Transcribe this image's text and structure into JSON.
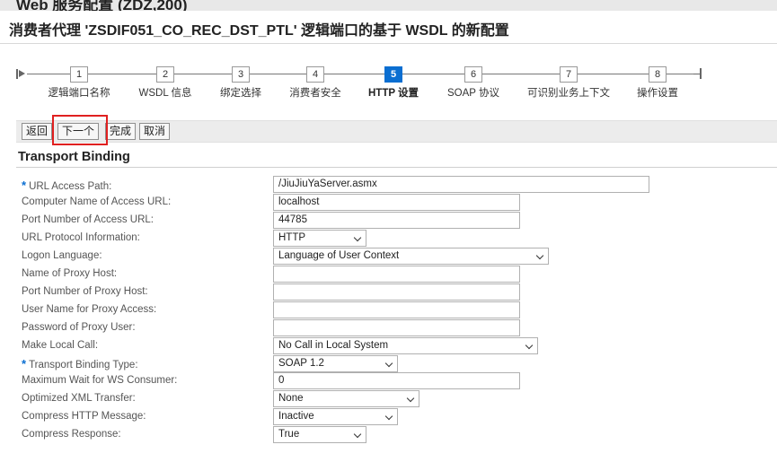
{
  "header": {
    "app_title": "Web 服务配置 (ZDZ,200)",
    "page_title": "消费者代理 'ZSDIF051_CO_REC_DST_PTL' 逻辑端口的基于 WSDL 的新配置"
  },
  "roadmap": {
    "steps": [
      {
        "num": "1",
        "label": "逻辑端口名称"
      },
      {
        "num": "2",
        "label": "WSDL 信息"
      },
      {
        "num": "3",
        "label": "绑定选择"
      },
      {
        "num": "4",
        "label": "消费者安全"
      },
      {
        "num": "5",
        "label": "HTTP 设置"
      },
      {
        "num": "6",
        "label": "SOAP 协议"
      },
      {
        "num": "7",
        "label": "可识别业务上下文"
      },
      {
        "num": "8",
        "label": "操作设置"
      }
    ],
    "active_step": "5"
  },
  "toolbar": {
    "back": "返回",
    "next": "下一个",
    "finish": "完成",
    "cancel": "取消"
  },
  "section": {
    "title": "Transport Binding"
  },
  "form": {
    "url_access_path": {
      "label": "URL Access Path:",
      "value": "/JiuJiuYaServer.asmx",
      "required": true
    },
    "computer_name": {
      "label": "Computer Name of Access URL:",
      "value": "localhost"
    },
    "port_number": {
      "label": "Port Number of Access URL:",
      "value": "44785"
    },
    "url_protocol": {
      "label": "URL Protocol Information:",
      "value": "HTTP"
    },
    "logon_language": {
      "label": "Logon Language:",
      "value": "Language of User Context"
    },
    "proxy_host": {
      "label": "Name of Proxy Host:",
      "value": ""
    },
    "proxy_port": {
      "label": "Port Number of Proxy Host:",
      "value": ""
    },
    "proxy_user": {
      "label": "User Name for Proxy Access:",
      "value": ""
    },
    "proxy_password": {
      "label": "Password of Proxy User:",
      "value": ""
    },
    "make_local_call": {
      "label": "Make Local Call:",
      "value": "No Call in Local System"
    },
    "transport_binding_type": {
      "label": "Transport Binding Type:",
      "value": "SOAP 1.2",
      "required": true
    },
    "max_wait": {
      "label": "Maximum Wait for WS Consumer:",
      "value": "0"
    },
    "optimized_xml": {
      "label": "Optimized XML Transfer:",
      "value": "None"
    },
    "compress_http": {
      "label": "Compress HTTP Message:",
      "value": "Inactive"
    },
    "compress_response": {
      "label": "Compress Response:",
      "value": "True"
    }
  },
  "colors": {
    "active_step": "#0a6ed1",
    "required_marker": "#0a6ed1",
    "highlight_box": "#e02020"
  }
}
